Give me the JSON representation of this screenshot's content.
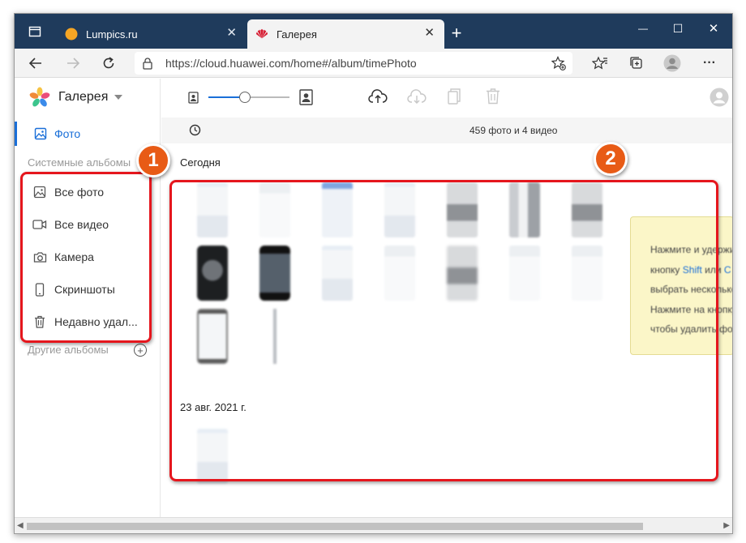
{
  "browser": {
    "tabs": [
      {
        "title": "Lumpics.ru",
        "close": "✕"
      },
      {
        "title": "Галерея",
        "close": "✕"
      }
    ],
    "new_tab": "+",
    "window_controls": {
      "minimize": "—",
      "maximize": "☐",
      "close": "✕"
    },
    "url": "https://cloud.huawei.com/home#/album/timePhoto",
    "more": "···"
  },
  "sidebar": {
    "app_title": "Галерея",
    "active_item": "Фото",
    "system_albums_title": "Системные альбомы",
    "albums": [
      {
        "label": "Все фото",
        "icon": "image-icon"
      },
      {
        "label": "Все видео",
        "icon": "video-icon"
      },
      {
        "label": "Камера",
        "icon": "camera-icon"
      },
      {
        "label": "Скриншоты",
        "icon": "phone-icon"
      },
      {
        "label": "Недавно удал...",
        "icon": "trash-icon"
      }
    ],
    "other_albums_title": "Другие альбомы",
    "add_symbol": "+"
  },
  "main": {
    "counter": "459 фото и 4 видео",
    "zoom_slider_value": 0.45,
    "groups": [
      {
        "date": "Сегодня"
      },
      {
        "date": "23 авг. 2021 г."
      }
    ]
  },
  "tooltip": {
    "lines": [
      {
        "before": "Нажмите и удерживайте",
        "highlight": "",
        "after": ""
      },
      {
        "before": "кнопку ",
        "highlight": "Shift",
        "after": " или "
      },
      {
        "before": "выбрать несколько",
        "highlight": "",
        "after": ""
      },
      {
        "before": "Нажмите на кнопку",
        "highlight": "",
        "after": ""
      },
      {
        "before": "чтобы удалить фото",
        "highlight": "",
        "after": ""
      }
    ],
    "line2_tail": "C"
  },
  "annotations": {
    "badge1": "1",
    "badge2": "2",
    "color": "#e5161d",
    "badge_color": "#e85b16"
  },
  "colors": {
    "tabbar": "#1f3b5c",
    "accent": "#1a6fd8"
  }
}
